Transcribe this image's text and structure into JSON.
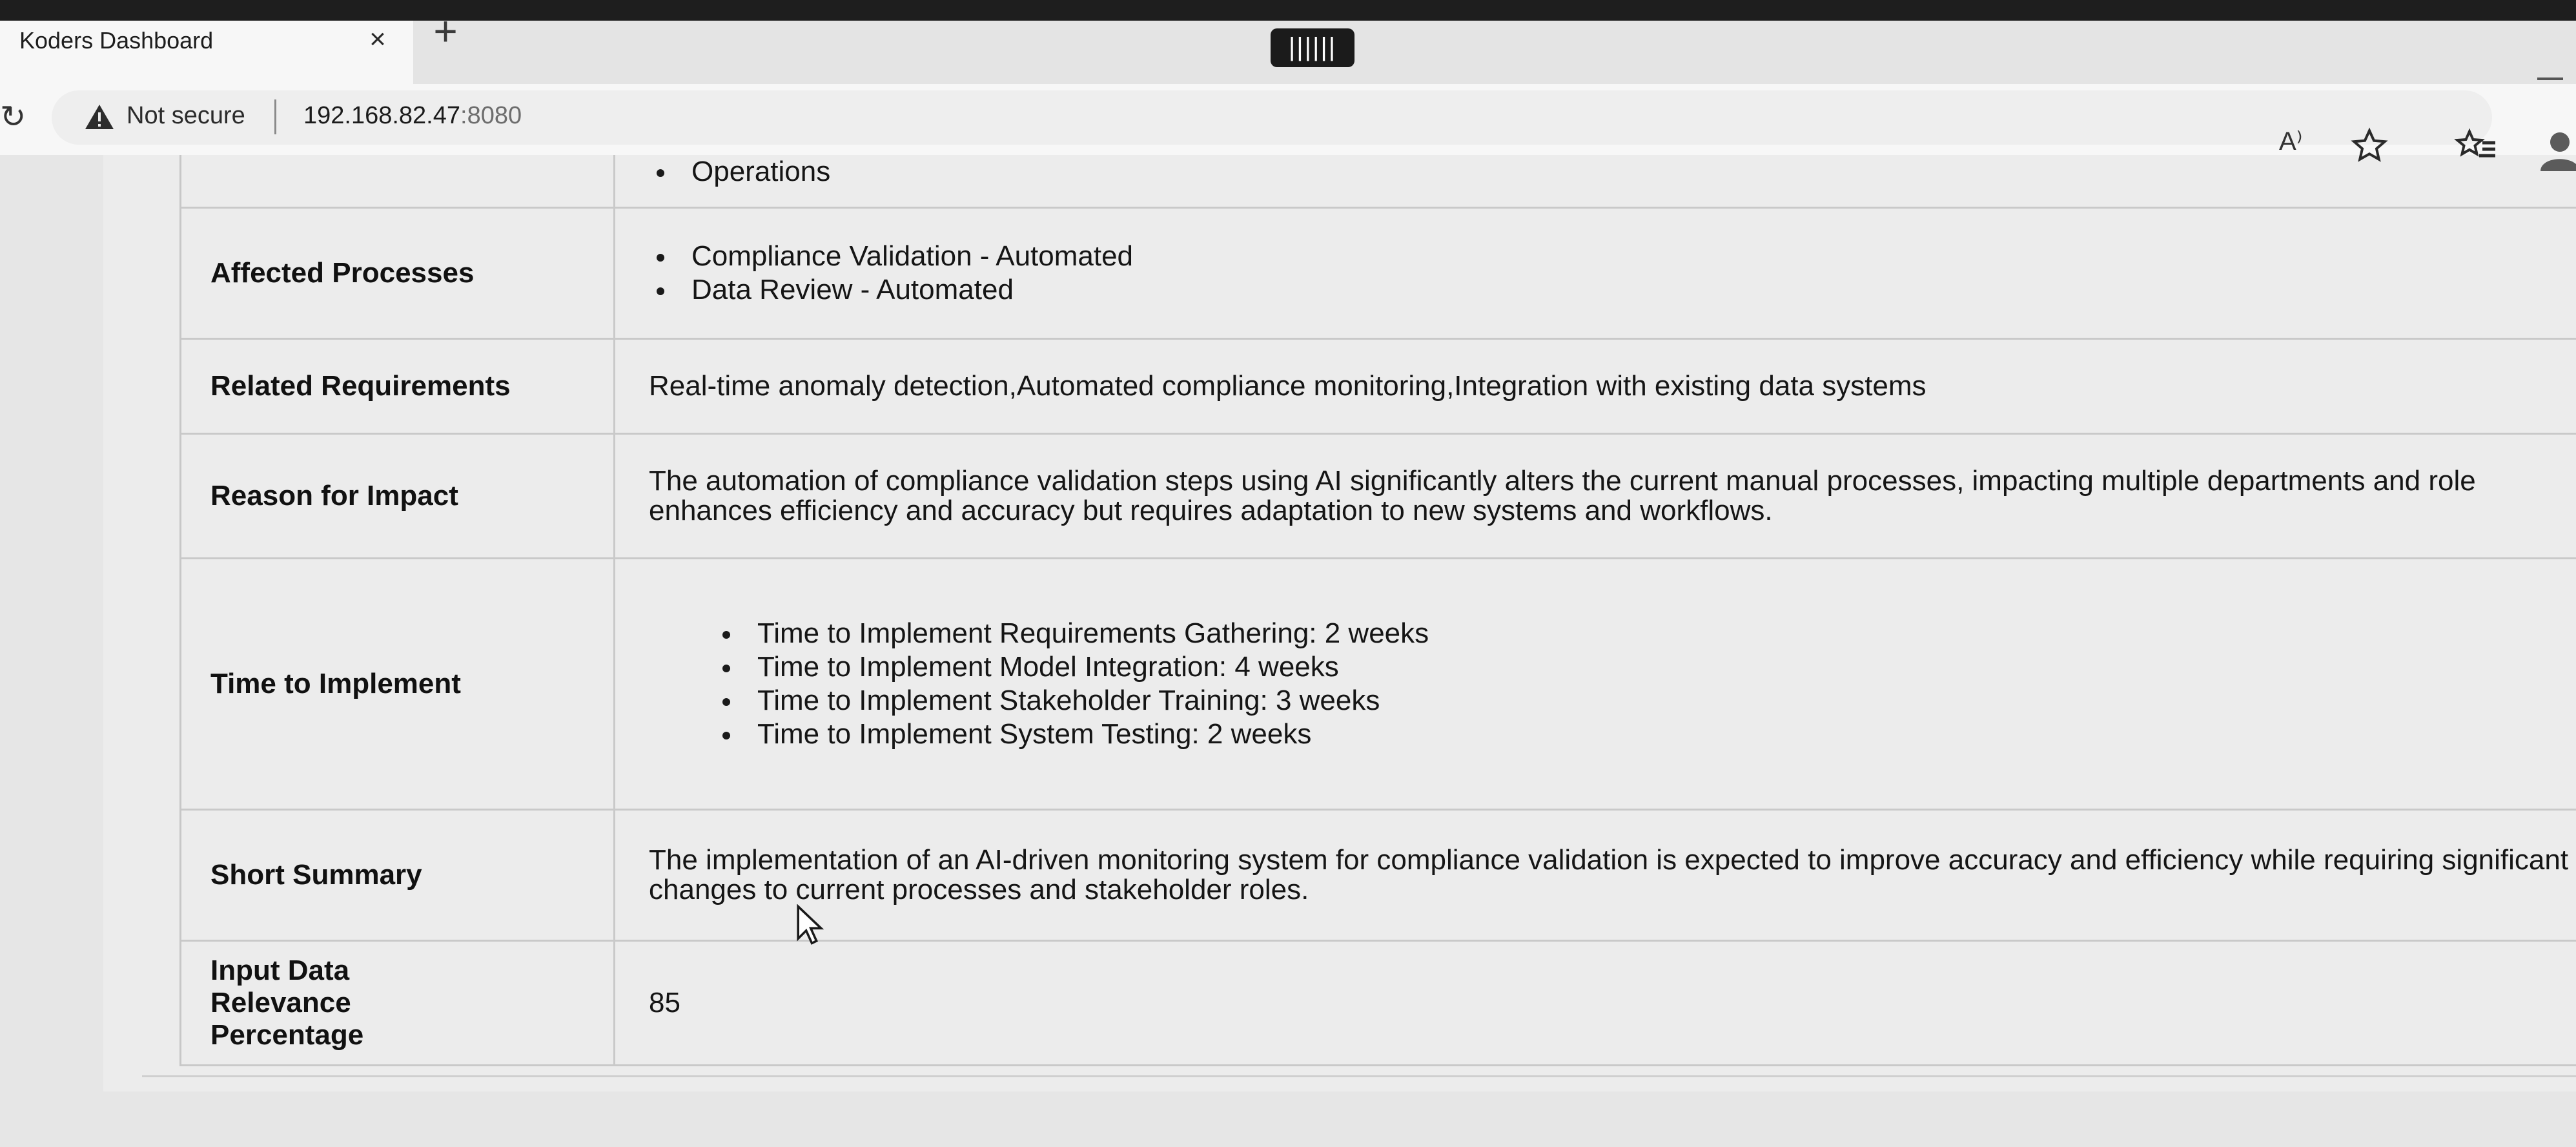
{
  "browser": {
    "tab_title": "Koders Dashboard",
    "tab_close": "×",
    "new_tab": "+",
    "drag_handle": "||||||",
    "security_label": "Not secure",
    "url_host": "192.168.82.47",
    "url_port": ":8080",
    "read_aloud": "A⁾"
  },
  "table": {
    "rows": [
      {
        "label": "",
        "items": [
          "Operations"
        ]
      },
      {
        "label": "Affected Processes",
        "items": [
          "Compliance Validation - Automated",
          "Data Review - Automated"
        ]
      },
      {
        "label": "Related Requirements",
        "value": "Real-time anomaly detection,Automated compliance monitoring,Integration with existing data systems"
      },
      {
        "label": "Reason for Impact",
        "value": "The automation of compliance validation steps using AI significantly alters the current manual processes, impacting multiple departments and role enhances efficiency and accuracy but requires adaptation to new systems and workflows."
      },
      {
        "label": "Time to Implement",
        "items": [
          "Time to Implement Requirements Gathering: 2 weeks",
          "Time to Implement Model Integration: 4 weeks",
          "Time to Implement Stakeholder Training: 3 weeks",
          "Time to Implement System Testing: 2 weeks"
        ]
      },
      {
        "label": "Short Summary",
        "value": "The implementation of an AI-driven monitoring system for compliance validation is expected to improve accuracy and efficiency while requiring significant changes to current processes and stakeholder roles."
      },
      {
        "label": "Input Data Relevance Percentage",
        "value": "85"
      }
    ]
  },
  "icons": {
    "warning": "warning-icon",
    "favorite": "star-outline-icon",
    "favorites_list": "favorites-list-icon",
    "profile": "profile-icon",
    "cursor": "mouse-pointer-icon"
  }
}
